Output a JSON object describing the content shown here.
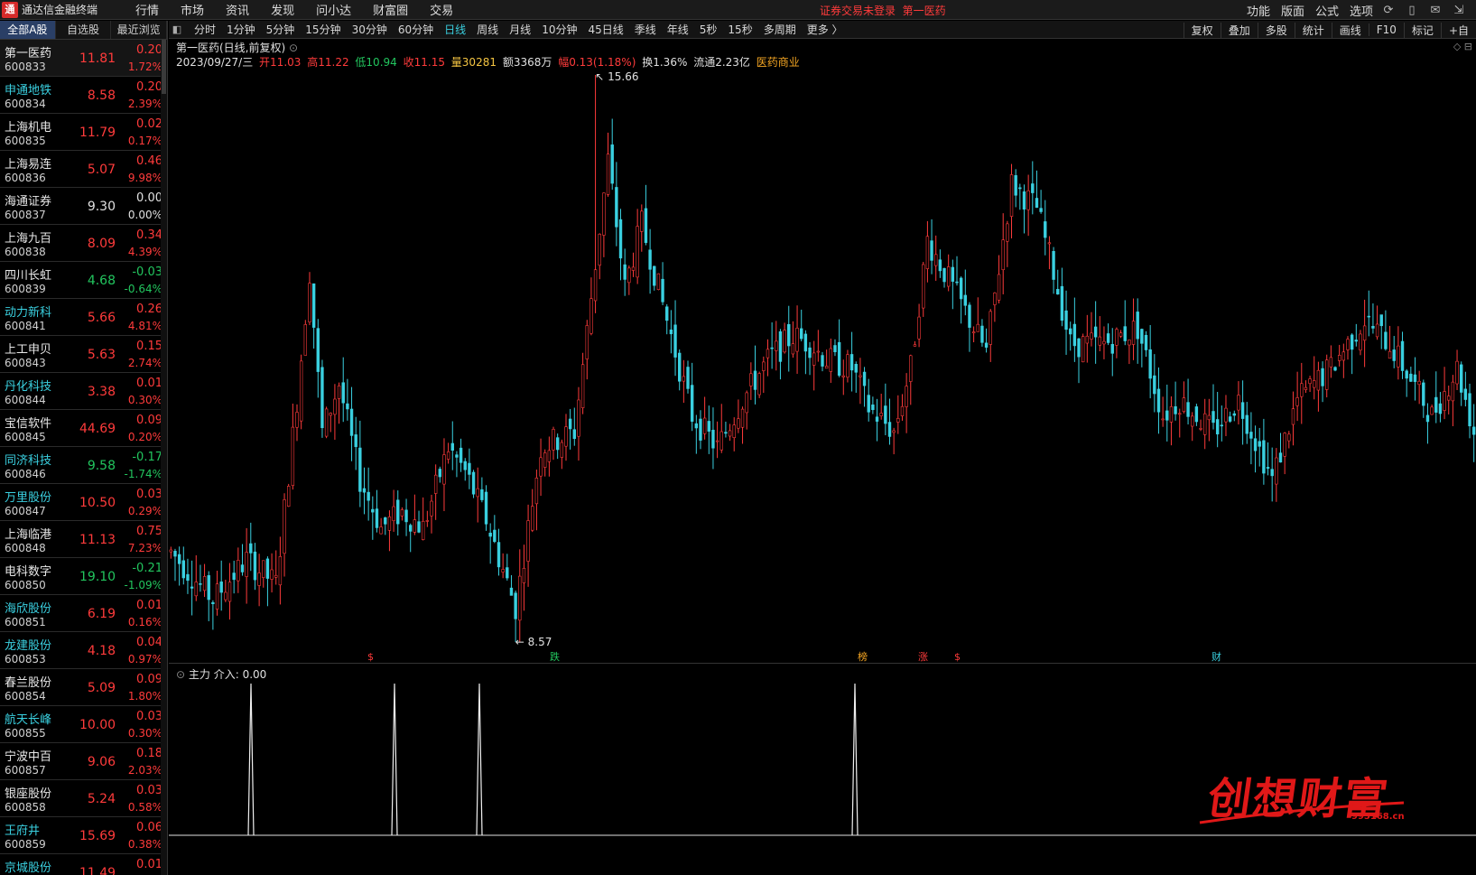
{
  "app": {
    "title": "通达信金融终端",
    "login_status": "证券交易未登录",
    "current_stock": "第一医药"
  },
  "menu": [
    "行情",
    "市场",
    "资讯",
    "发现",
    "问小达",
    "财富圈",
    "交易"
  ],
  "right_menu": [
    "功能",
    "版面",
    "公式",
    "选项"
  ],
  "list_tabs": [
    "全部A股",
    "自选股",
    "最近浏览"
  ],
  "stocks": [
    {
      "name": "第一医药",
      "code": "600833",
      "price": "11.81",
      "chg": "0.20",
      "pct": "1.72%",
      "dir": "up",
      "cyan": false
    },
    {
      "name": "申通地铁",
      "code": "600834",
      "price": "8.58",
      "chg": "0.20",
      "pct": "2.39%",
      "dir": "up",
      "cyan": true
    },
    {
      "name": "上海机电",
      "code": "600835",
      "price": "11.79",
      "chg": "0.02",
      "pct": "0.17%",
      "dir": "up",
      "cyan": false
    },
    {
      "name": "上海易连",
      "code": "600836",
      "price": "5.07",
      "chg": "0.46",
      "pct": "9.98%",
      "dir": "up",
      "cyan": false
    },
    {
      "name": "海通证券",
      "code": "600837",
      "price": "9.30",
      "chg": "0.00",
      "pct": "0.00%",
      "dir": "flat",
      "cyan": false
    },
    {
      "name": "上海九百",
      "code": "600838",
      "price": "8.09",
      "chg": "0.34",
      "pct": "4.39%",
      "dir": "up",
      "cyan": false
    },
    {
      "name": "四川长虹",
      "code": "600839",
      "price": "4.68",
      "chg": "-0.03",
      "pct": "-0.64%",
      "dir": "dn",
      "cyan": false
    },
    {
      "name": "动力新科",
      "code": "600841",
      "price": "5.66",
      "chg": "0.26",
      "pct": "4.81%",
      "dir": "up",
      "cyan": true
    },
    {
      "name": "上工申贝",
      "code": "600843",
      "price": "5.63",
      "chg": "0.15",
      "pct": "2.74%",
      "dir": "up",
      "cyan": false
    },
    {
      "name": "丹化科技",
      "code": "600844",
      "price": "3.38",
      "chg": "0.01",
      "pct": "0.30%",
      "dir": "up",
      "cyan": true
    },
    {
      "name": "宝信软件",
      "code": "600845",
      "price": "44.69",
      "chg": "0.09",
      "pct": "0.20%",
      "dir": "up",
      "cyan": false
    },
    {
      "name": "同济科技",
      "code": "600846",
      "price": "9.58",
      "chg": "-0.17",
      "pct": "-1.74%",
      "dir": "dn",
      "cyan": true
    },
    {
      "name": "万里股份",
      "code": "600847",
      "price": "10.50",
      "chg": "0.03",
      "pct": "0.29%",
      "dir": "up",
      "cyan": true
    },
    {
      "name": "上海临港",
      "code": "600848",
      "price": "11.13",
      "chg": "0.75",
      "pct": "7.23%",
      "dir": "up",
      "cyan": false
    },
    {
      "name": "电科数字",
      "code": "600850",
      "price": "19.10",
      "chg": "-0.21",
      "pct": "-1.09%",
      "dir": "dn",
      "cyan": false
    },
    {
      "name": "海欣股份",
      "code": "600851",
      "price": "6.19",
      "chg": "0.01",
      "pct": "0.16%",
      "dir": "up",
      "cyan": true
    },
    {
      "name": "龙建股份",
      "code": "600853",
      "price": "4.18",
      "chg": "0.04",
      "pct": "0.97%",
      "dir": "up",
      "cyan": true
    },
    {
      "name": "春兰股份",
      "code": "600854",
      "price": "5.09",
      "chg": "0.09",
      "pct": "1.80%",
      "dir": "up",
      "cyan": false
    },
    {
      "name": "航天长峰",
      "code": "600855",
      "price": "10.00",
      "chg": "0.03",
      "pct": "0.30%",
      "dir": "up",
      "cyan": true
    },
    {
      "name": "宁波中百",
      "code": "600857",
      "price": "9.06",
      "chg": "0.18",
      "pct": "2.03%",
      "dir": "up",
      "cyan": false
    },
    {
      "name": "银座股份",
      "code": "600858",
      "price": "5.24",
      "chg": "0.03",
      "pct": "0.58%",
      "dir": "up",
      "cyan": false
    },
    {
      "name": "王府井",
      "code": "600859",
      "price": "15.69",
      "chg": "0.06",
      "pct": "0.38%",
      "dir": "up",
      "cyan": true
    },
    {
      "name": "京城股份",
      "code": "",
      "price": "11.49",
      "chg": "0.01",
      "pct": "",
      "dir": "up",
      "cyan": true
    }
  ],
  "periods": [
    "分时",
    "1分钟",
    "5分钟",
    "15分钟",
    "30分钟",
    "60分钟",
    "日线",
    "周线",
    "月线",
    "10分钟",
    "45日线",
    "季线",
    "年线",
    "5秒",
    "15秒",
    "多周期",
    "更多 〉"
  ],
  "active_period": "日线",
  "period_tools": [
    "复权",
    "叠加",
    "多股",
    "统计",
    "画线",
    "F10",
    "标记",
    "+自"
  ],
  "chart": {
    "title": "第一医药(日线,前复权)",
    "date": "2023/09/27/三",
    "open": "开11.03",
    "high": "高11.22",
    "low": "低10.94",
    "close": "收11.15",
    "volume": "量30281",
    "amount": "额3368万",
    "change": "幅0.13(1.18%)",
    "turnover": "换1.36%",
    "float_cap": "流通2.23亿",
    "sector": "医药商业",
    "max_label": "15.66",
    "min_label": "8.57",
    "markers": [
      {
        "text": "$",
        "color": "#ff3b3b"
      },
      {
        "text": "跌",
        "color": "#22c55e"
      },
      {
        "text": "榜",
        "color": "#f5a623"
      },
      {
        "text": "涨",
        "color": "#ff3b3b"
      },
      {
        "text": "$",
        "color": "#ff3b3b"
      },
      {
        "text": "财",
        "color": "#3ad0e0"
      }
    ]
  },
  "chart_data": {
    "type": "candlestick",
    "y_range": [
      8.57,
      15.66
    ],
    "high_point": 15.66,
    "low_point": 8.57,
    "last_close": 11.15
  },
  "indicator": {
    "label": "主力 介入: 0.00",
    "spike_count": 4
  },
  "watermark": {
    "cn": "创想财富",
    "url": "995168.cn"
  },
  "colors": {
    "up": "#ff3b3b",
    "down": "#3ad0e0",
    "accent": "#3ad0e0"
  }
}
